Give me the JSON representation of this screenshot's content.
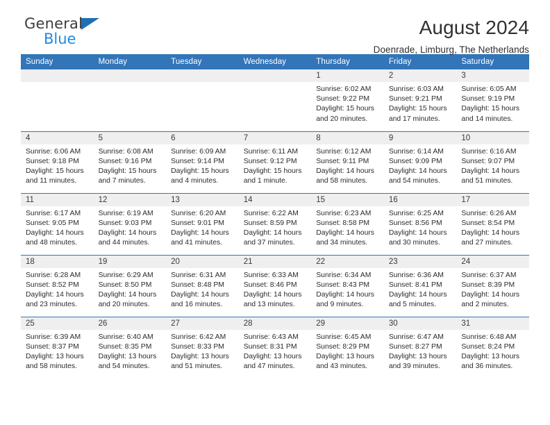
{
  "brand": {
    "general": "General",
    "blue": "Blue",
    "flag_color": "#1f6fb5",
    "blue_color": "#1f8ae0"
  },
  "header": {
    "title": "August 2024",
    "subtitle": "Doenrade, Limburg, The Netherlands"
  },
  "theme": {
    "header_bg": "#3275b8",
    "daynum_bg": "#efefef",
    "separator": "#3275b8"
  },
  "weekdays": [
    "Sunday",
    "Monday",
    "Tuesday",
    "Wednesday",
    "Thursday",
    "Friday",
    "Saturday"
  ],
  "weeks": [
    [
      {
        "day": "",
        "empty": true
      },
      {
        "day": "",
        "empty": true
      },
      {
        "day": "",
        "empty": true
      },
      {
        "day": "",
        "empty": true
      },
      {
        "day": "1",
        "sunrise": "Sunrise: 6:02 AM",
        "sunset": "Sunset: 9:22 PM",
        "daylight1": "Daylight: 15 hours",
        "daylight2": "and 20 minutes."
      },
      {
        "day": "2",
        "sunrise": "Sunrise: 6:03 AM",
        "sunset": "Sunset: 9:21 PM",
        "daylight1": "Daylight: 15 hours",
        "daylight2": "and 17 minutes."
      },
      {
        "day": "3",
        "sunrise": "Sunrise: 6:05 AM",
        "sunset": "Sunset: 9:19 PM",
        "daylight1": "Daylight: 15 hours",
        "daylight2": "and 14 minutes."
      }
    ],
    [
      {
        "day": "4",
        "sunrise": "Sunrise: 6:06 AM",
        "sunset": "Sunset: 9:18 PM",
        "daylight1": "Daylight: 15 hours",
        "daylight2": "and 11 minutes."
      },
      {
        "day": "5",
        "sunrise": "Sunrise: 6:08 AM",
        "sunset": "Sunset: 9:16 PM",
        "daylight1": "Daylight: 15 hours",
        "daylight2": "and 7 minutes."
      },
      {
        "day": "6",
        "sunrise": "Sunrise: 6:09 AM",
        "sunset": "Sunset: 9:14 PM",
        "daylight1": "Daylight: 15 hours",
        "daylight2": "and 4 minutes."
      },
      {
        "day": "7",
        "sunrise": "Sunrise: 6:11 AM",
        "sunset": "Sunset: 9:12 PM",
        "daylight1": "Daylight: 15 hours",
        "daylight2": "and 1 minute."
      },
      {
        "day": "8",
        "sunrise": "Sunrise: 6:12 AM",
        "sunset": "Sunset: 9:11 PM",
        "daylight1": "Daylight: 14 hours",
        "daylight2": "and 58 minutes."
      },
      {
        "day": "9",
        "sunrise": "Sunrise: 6:14 AM",
        "sunset": "Sunset: 9:09 PM",
        "daylight1": "Daylight: 14 hours",
        "daylight2": "and 54 minutes."
      },
      {
        "day": "10",
        "sunrise": "Sunrise: 6:16 AM",
        "sunset": "Sunset: 9:07 PM",
        "daylight1": "Daylight: 14 hours",
        "daylight2": "and 51 minutes."
      }
    ],
    [
      {
        "day": "11",
        "sunrise": "Sunrise: 6:17 AM",
        "sunset": "Sunset: 9:05 PM",
        "daylight1": "Daylight: 14 hours",
        "daylight2": "and 48 minutes."
      },
      {
        "day": "12",
        "sunrise": "Sunrise: 6:19 AM",
        "sunset": "Sunset: 9:03 PM",
        "daylight1": "Daylight: 14 hours",
        "daylight2": "and 44 minutes."
      },
      {
        "day": "13",
        "sunrise": "Sunrise: 6:20 AM",
        "sunset": "Sunset: 9:01 PM",
        "daylight1": "Daylight: 14 hours",
        "daylight2": "and 41 minutes."
      },
      {
        "day": "14",
        "sunrise": "Sunrise: 6:22 AM",
        "sunset": "Sunset: 8:59 PM",
        "daylight1": "Daylight: 14 hours",
        "daylight2": "and 37 minutes."
      },
      {
        "day": "15",
        "sunrise": "Sunrise: 6:23 AM",
        "sunset": "Sunset: 8:58 PM",
        "daylight1": "Daylight: 14 hours",
        "daylight2": "and 34 minutes."
      },
      {
        "day": "16",
        "sunrise": "Sunrise: 6:25 AM",
        "sunset": "Sunset: 8:56 PM",
        "daylight1": "Daylight: 14 hours",
        "daylight2": "and 30 minutes."
      },
      {
        "day": "17",
        "sunrise": "Sunrise: 6:26 AM",
        "sunset": "Sunset: 8:54 PM",
        "daylight1": "Daylight: 14 hours",
        "daylight2": "and 27 minutes."
      }
    ],
    [
      {
        "day": "18",
        "sunrise": "Sunrise: 6:28 AM",
        "sunset": "Sunset: 8:52 PM",
        "daylight1": "Daylight: 14 hours",
        "daylight2": "and 23 minutes."
      },
      {
        "day": "19",
        "sunrise": "Sunrise: 6:29 AM",
        "sunset": "Sunset: 8:50 PM",
        "daylight1": "Daylight: 14 hours",
        "daylight2": "and 20 minutes."
      },
      {
        "day": "20",
        "sunrise": "Sunrise: 6:31 AM",
        "sunset": "Sunset: 8:48 PM",
        "daylight1": "Daylight: 14 hours",
        "daylight2": "and 16 minutes."
      },
      {
        "day": "21",
        "sunrise": "Sunrise: 6:33 AM",
        "sunset": "Sunset: 8:46 PM",
        "daylight1": "Daylight: 14 hours",
        "daylight2": "and 13 minutes."
      },
      {
        "day": "22",
        "sunrise": "Sunrise: 6:34 AM",
        "sunset": "Sunset: 8:43 PM",
        "daylight1": "Daylight: 14 hours",
        "daylight2": "and 9 minutes."
      },
      {
        "day": "23",
        "sunrise": "Sunrise: 6:36 AM",
        "sunset": "Sunset: 8:41 PM",
        "daylight1": "Daylight: 14 hours",
        "daylight2": "and 5 minutes."
      },
      {
        "day": "24",
        "sunrise": "Sunrise: 6:37 AM",
        "sunset": "Sunset: 8:39 PM",
        "daylight1": "Daylight: 14 hours",
        "daylight2": "and 2 minutes."
      }
    ],
    [
      {
        "day": "25",
        "sunrise": "Sunrise: 6:39 AM",
        "sunset": "Sunset: 8:37 PM",
        "daylight1": "Daylight: 13 hours",
        "daylight2": "and 58 minutes."
      },
      {
        "day": "26",
        "sunrise": "Sunrise: 6:40 AM",
        "sunset": "Sunset: 8:35 PM",
        "daylight1": "Daylight: 13 hours",
        "daylight2": "and 54 minutes."
      },
      {
        "day": "27",
        "sunrise": "Sunrise: 6:42 AM",
        "sunset": "Sunset: 8:33 PM",
        "daylight1": "Daylight: 13 hours",
        "daylight2": "and 51 minutes."
      },
      {
        "day": "28",
        "sunrise": "Sunrise: 6:43 AM",
        "sunset": "Sunset: 8:31 PM",
        "daylight1": "Daylight: 13 hours",
        "daylight2": "and 47 minutes."
      },
      {
        "day": "29",
        "sunrise": "Sunrise: 6:45 AM",
        "sunset": "Sunset: 8:29 PM",
        "daylight1": "Daylight: 13 hours",
        "daylight2": "and 43 minutes."
      },
      {
        "day": "30",
        "sunrise": "Sunrise: 6:47 AM",
        "sunset": "Sunset: 8:27 PM",
        "daylight1": "Daylight: 13 hours",
        "daylight2": "and 39 minutes."
      },
      {
        "day": "31",
        "sunrise": "Sunrise: 6:48 AM",
        "sunset": "Sunset: 8:24 PM",
        "daylight1": "Daylight: 13 hours",
        "daylight2": "and 36 minutes."
      }
    ]
  ]
}
